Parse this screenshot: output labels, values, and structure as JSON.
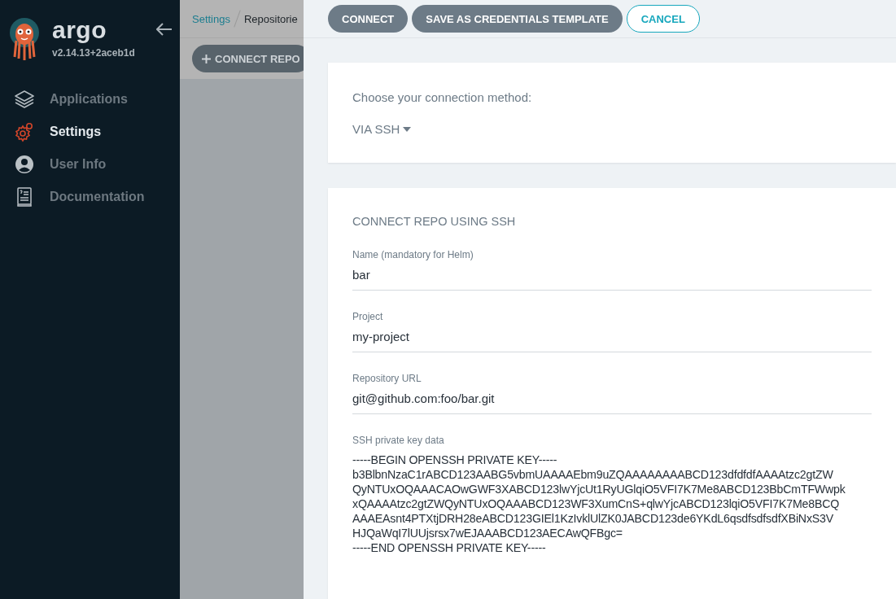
{
  "sidebar": {
    "logo_text": "argo",
    "version": "v2.14.13+2aceb1d",
    "items": [
      {
        "label": "Applications",
        "kind": "layers",
        "selected": false
      },
      {
        "label": "Settings",
        "kind": "gear",
        "selected": true
      },
      {
        "label": "User Info",
        "kind": "user",
        "selected": false
      },
      {
        "label": "Documentation",
        "kind": "book",
        "selected": false
      }
    ]
  },
  "breadcrumbs": [
    "Settings",
    "Repositorie"
  ],
  "toolbar": {
    "connect_repo_button": "CONNECT REPO"
  },
  "panel": {
    "buttons": [
      {
        "label": "CONNECT",
        "kind": "filled"
      },
      {
        "label": "SAVE AS CREDENTIALS TEMPLATE",
        "kind": "filled"
      },
      {
        "label": "CANCEL",
        "kind": "outline"
      }
    ],
    "method": {
      "prompt": "Choose your connection method:",
      "value": "VIA SSH"
    },
    "form": {
      "title": "CONNECT REPO USING SSH",
      "fields": [
        {
          "label": "Name (mandatory for Helm)",
          "value": "bar",
          "kind": "text"
        },
        {
          "label": "Project",
          "value": "my-project",
          "kind": "text"
        },
        {
          "label": "Repository URL",
          "value": "git@github.com:foo/bar.git",
          "kind": "text"
        },
        {
          "label": "SSH private key data",
          "kind": "textarea",
          "lines": [
            "-----BEGIN OPENSSH PRIVATE KEY-----",
            "b3BlbnNzaC1rABCD123AABG5vbmUAAAAEbm9uZQAAAAAAAABCD123dfdfdfAAAAtzc2gtZW",
            "QyNTUxOQAAACAOwGWF3XABCD123lwYjcUt1RyUGlqiO5VFI7K7Me8ABCD123BbCmTFWwpk",
            "xQAAAAtzc2gtZWQyNTUxOQAAABCD123WF3XumCnS+qlwYjcABCD123lqiO5VFI7K7Me8BCQ",
            "AAAEAsnt4PTXtjDRH28eABCD123GIEl1KzIvklUlZK0JABCD123de6YKdL6qsdfsdfsdfXBiNxS3V",
            "HJQaWqI7lUUjsrsx7wEJAAABCD123AECAwQFBgc=",
            "-----END OPENSSH PRIVATE KEY-----"
          ]
        }
      ]
    }
  }
}
